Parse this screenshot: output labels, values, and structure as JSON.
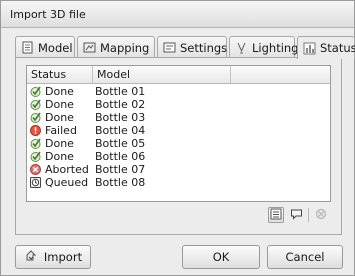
{
  "window": {
    "title": "Import 3D file"
  },
  "tabs": [
    {
      "label": "Model",
      "icon": "document-icon"
    },
    {
      "label": "Mapping",
      "icon": "mapping-icon"
    },
    {
      "label": "Settings",
      "icon": "settings-icon"
    },
    {
      "label": "Lighting",
      "icon": "bulb-icon"
    },
    {
      "label": "Status",
      "icon": "bar-chart-icon",
      "active": true
    }
  ],
  "table": {
    "columns": [
      "Status",
      "Model",
      ""
    ],
    "rows": [
      {
        "status": "Done",
        "icon": "check-icon",
        "model": "Bottle 01"
      },
      {
        "status": "Done",
        "icon": "check-icon",
        "model": "Bottle 02"
      },
      {
        "status": "Done",
        "icon": "check-icon",
        "model": "Bottle 03"
      },
      {
        "status": "Failed",
        "icon": "error-icon",
        "model": "Bottle 04"
      },
      {
        "status": "Done",
        "icon": "check-icon",
        "model": "Bottle 05"
      },
      {
        "status": "Done",
        "icon": "check-icon",
        "model": "Bottle 06"
      },
      {
        "status": "Aborted",
        "icon": "cancel-icon",
        "model": "Bottle 07"
      },
      {
        "status": "Queued",
        "icon": "clock-icon",
        "model": "Bottle 08"
      }
    ]
  },
  "buttons": {
    "import": "Import",
    "ok": "OK",
    "cancel": "Cancel"
  },
  "colors": {
    "done": "#3f7d2a",
    "failed": "#d03a2a",
    "aborted": "#c94848",
    "queued": "#555555"
  }
}
